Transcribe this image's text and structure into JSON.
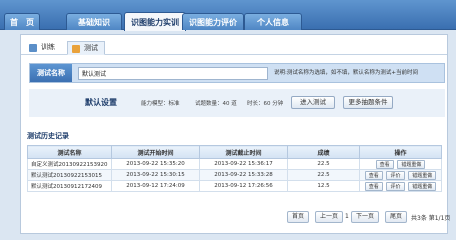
{
  "topnav": {
    "tabs": [
      {
        "label": "首　页"
      },
      {
        "label": "基础知识"
      },
      {
        "label": "识图能力实训"
      },
      {
        "label": "识图能力评价"
      },
      {
        "label": "个人信息"
      }
    ],
    "active_index": 2
  },
  "subtabs": [
    {
      "label": "训练"
    },
    {
      "label": "测试"
    }
  ],
  "name_bar": {
    "label": "测试名称",
    "value": "默认测试",
    "hint": "说明:测试名称为选填，如不填，默认名称为测试+当前时间"
  },
  "settings": {
    "title": "默认设置",
    "mode": "能力模型：标准",
    "count": "试题数量：40 道",
    "duration": "时长：60 分钟",
    "enter_button": "进入测试",
    "more_button": "更多抽题条件"
  },
  "history": {
    "title": "测试历史记录",
    "columns": [
      "测试名称",
      "测试开始时间",
      "测试截止时间",
      "成绩",
      "操作"
    ],
    "rows": [
      {
        "name": "自定义测试20130922153920",
        "start": "2013-09-22 15:35:20",
        "end": "2013-09-22 15:36:17",
        "score": "22.5",
        "actions": [
          "查看",
          "错题重做"
        ]
      },
      {
        "name": "默认测试20130922153015",
        "start": "2013-09-22 15:30:15",
        "end": "2013-09-22 15:33:28",
        "score": "22.5",
        "actions": [
          "查看",
          "评价",
          "错题重做"
        ]
      },
      {
        "name": "默认测试20130912172409",
        "start": "2013-09-12 17:24:09",
        "end": "2013-09-12 17:26:56",
        "score": "12.5",
        "actions": [
          "查看",
          "评价",
          "错题重做"
        ]
      }
    ]
  },
  "pager": {
    "first": "首页",
    "prev": "上一页",
    "current": "1",
    "next": "下一页",
    "last": "尾页",
    "summary": "共3条  第1/1页"
  },
  "colors": {
    "nav_blue": "#3a6fb0",
    "panel_bg": "#ffffff",
    "label_blue": "#3b70b2",
    "text_dark_blue": "#1e3d6b"
  }
}
